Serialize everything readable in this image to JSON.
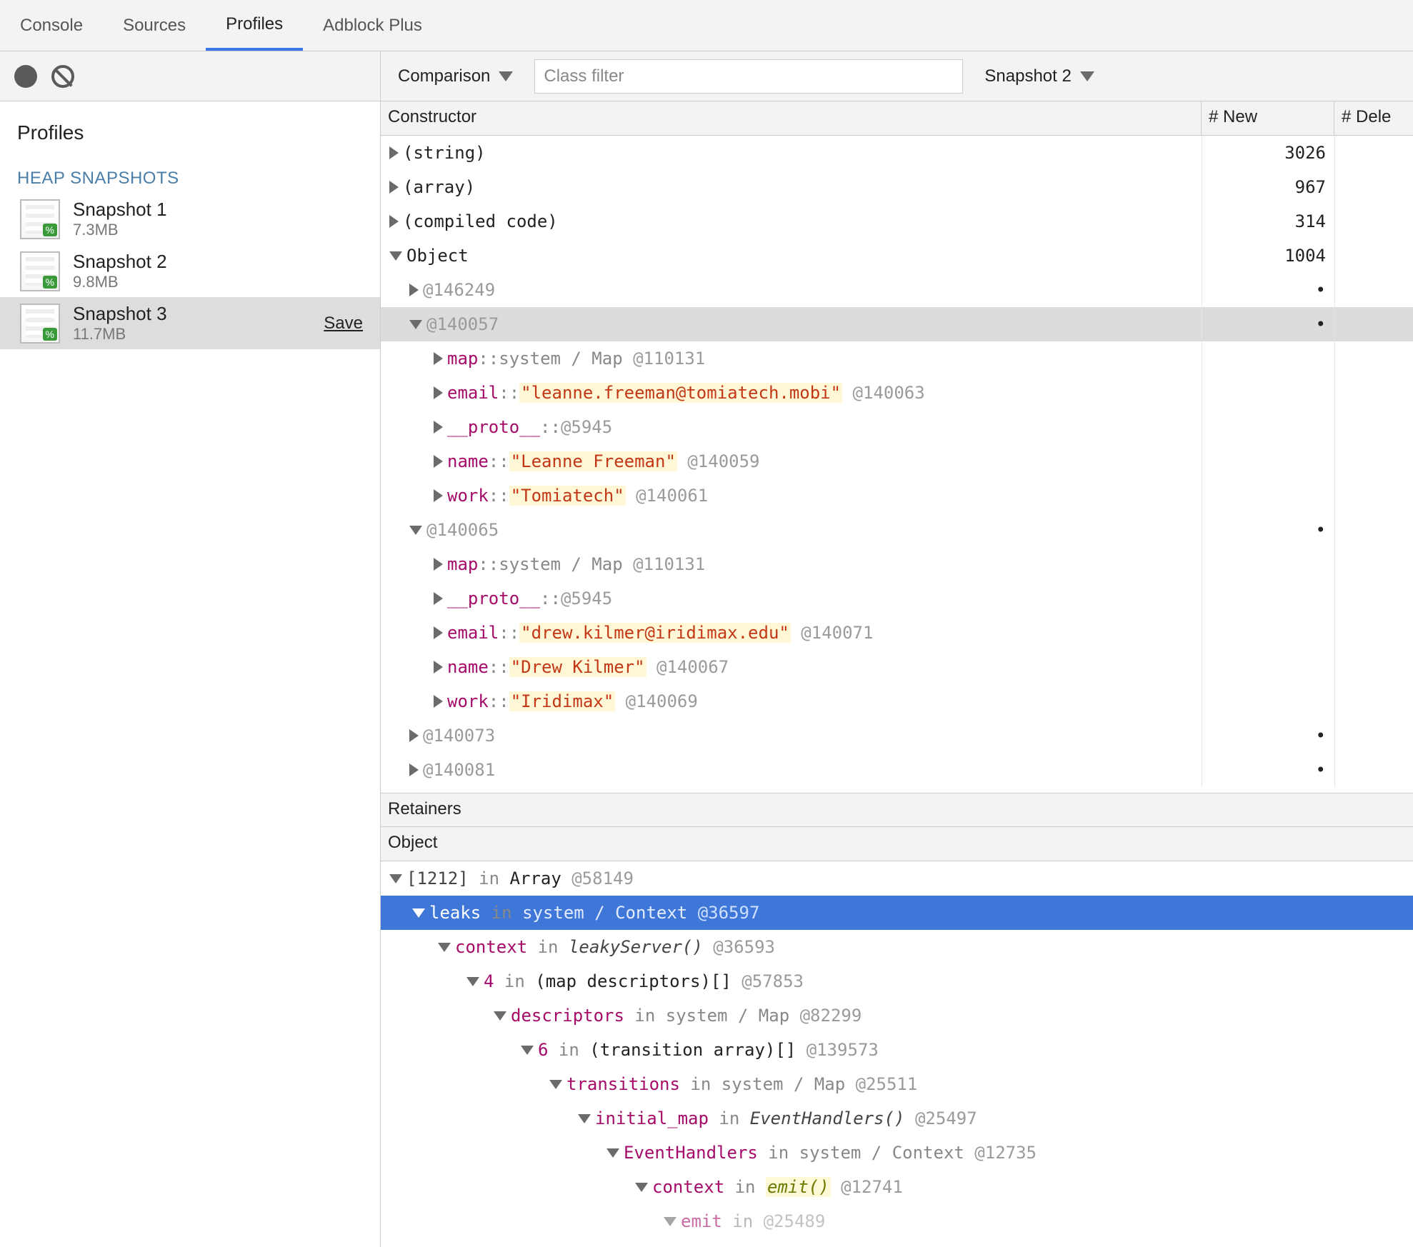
{
  "tabs": {
    "console": "Console",
    "sources": "Sources",
    "profiles": "Profiles",
    "adblock": "Adblock Plus"
  },
  "sidebar": {
    "profiles_title": "Profiles",
    "heap_title": "HEAP SNAPSHOTS",
    "snapshots": [
      {
        "name": "Snapshot 1",
        "size": "7.3MB"
      },
      {
        "name": "Snapshot 2",
        "size": "9.8MB"
      },
      {
        "name": "Snapshot 3",
        "size": "11.7MB"
      }
    ],
    "save_label": "Save"
  },
  "toolbar": {
    "comparison": "Comparison",
    "filter_placeholder": "Class filter",
    "snapshot_cmp": "Snapshot 2"
  },
  "grid": {
    "col_constructor": "Constructor",
    "col_new": "# New",
    "col_del": "# Dele",
    "rows": {
      "string": {
        "label": "(string)",
        "new": "3026"
      },
      "array": {
        "label": "(array)",
        "new": "967"
      },
      "compiled": {
        "label": "(compiled code)",
        "new": "314"
      },
      "object": {
        "label": "Object",
        "new": "1004"
      },
      "o146249": {
        "addr": "@146249",
        "dot": "•"
      },
      "o140057": {
        "addr": "@140057",
        "dot": "•"
      },
      "o140057_map": {
        "prop": "map",
        "sep": " :: ",
        "val": "system / Map",
        "addr": "@110131"
      },
      "o140057_email": {
        "prop": "email",
        "sep": " :: ",
        "val": "\"leanne.freeman@tomiatech.mobi\"",
        "addr": "@140063"
      },
      "o140057_proto": {
        "prop": "__proto__",
        "sep": " :: ",
        "addr": "@5945"
      },
      "o140057_name": {
        "prop": "name",
        "sep": " :: ",
        "val": "\"Leanne Freeman\"",
        "addr": "@140059"
      },
      "o140057_work": {
        "prop": "work",
        "sep": " :: ",
        "val": "\"Tomiatech\"",
        "addr": "@140061"
      },
      "o140065": {
        "addr": "@140065",
        "dot": "•"
      },
      "o140065_map": {
        "prop": "map",
        "sep": " :: ",
        "val": "system / Map",
        "addr": "@110131"
      },
      "o140065_proto": {
        "prop": "__proto__",
        "sep": " :: ",
        "addr": "@5945"
      },
      "o140065_email": {
        "prop": "email",
        "sep": " :: ",
        "val": "\"drew.kilmer@iridimax.edu\"",
        "addr": "@140071"
      },
      "o140065_name": {
        "prop": "name",
        "sep": " :: ",
        "val": "\"Drew Kilmer\"",
        "addr": "@140067"
      },
      "o140065_work": {
        "prop": "work",
        "sep": " :: ",
        "val": "\"Iridimax\"",
        "addr": "@140069"
      },
      "o140073": {
        "addr": "@140073",
        "dot": "•"
      },
      "o140081": {
        "addr": "@140081",
        "dot": "•"
      }
    }
  },
  "retainers": {
    "title": "Retainers",
    "object_col": "Object",
    "rows": {
      "r0": {
        "key": "[1212]",
        "in": "in",
        "type": "Array",
        "addr": "@58149"
      },
      "r1": {
        "key": "leaks",
        "in": "in",
        "type": "system / Context",
        "addr": "@36597"
      },
      "r2": {
        "key": "context",
        "in": "in",
        "fn": "leakyServer()",
        "addr": "@36593"
      },
      "r3": {
        "key": "4",
        "in": "in",
        "type": "(map descriptors)[]",
        "addr": "@57853"
      },
      "r4": {
        "key": "descriptors",
        "in": "in",
        "type": "system / Map",
        "addr": "@82299"
      },
      "r5": {
        "key": "6",
        "in": "in",
        "type": "(transition array)[]",
        "addr": "@139573"
      },
      "r6": {
        "key": "transitions",
        "in": "in",
        "type": "system / Map",
        "addr": "@25511"
      },
      "r7": {
        "key": "initial_map",
        "in": "in",
        "fn": "EventHandlers()",
        "addr": "@25497"
      },
      "r8": {
        "key": "EventHandlers",
        "in": "in",
        "type": "system / Context",
        "addr": "@12735"
      },
      "r9": {
        "key": "context",
        "in": "in",
        "fn": "emit()",
        "addr": "@12741"
      },
      "r10": {
        "key": "emit",
        "in": "in",
        "addr": "@25489"
      }
    }
  }
}
